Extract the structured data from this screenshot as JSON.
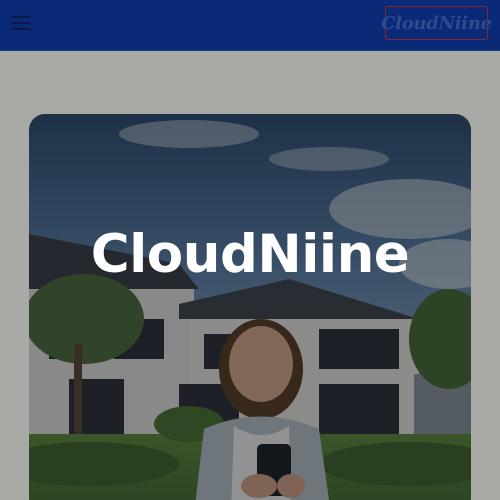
{
  "header": {
    "menu_icon": "hamburger-menu-icon",
    "logo_text": "CloudNiine"
  },
  "hero": {
    "title": "CloudNiine",
    "image": "woman-with-phone-in-front-of-modern-house"
  },
  "colors": {
    "header_bg": "#0a2a78",
    "logo_border": "#8b2530",
    "page_bg": "#a9a9a6",
    "hero_title": "#ffffff"
  }
}
